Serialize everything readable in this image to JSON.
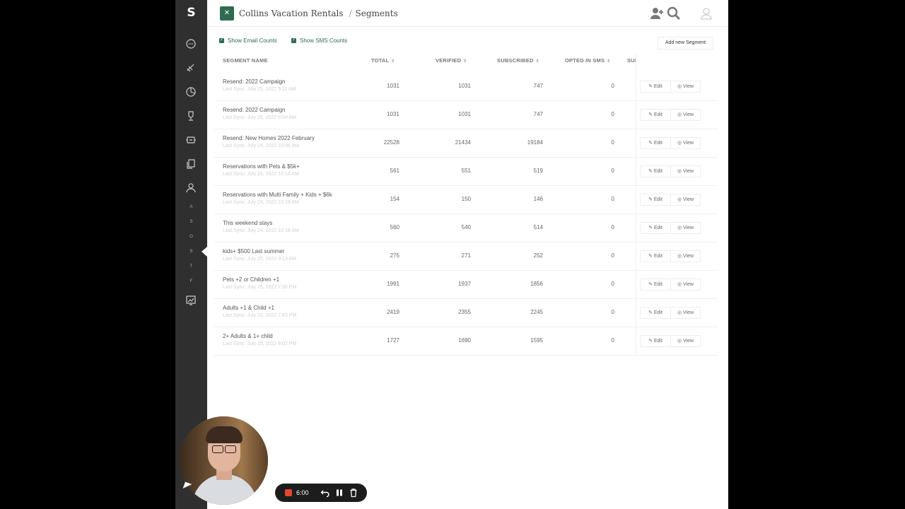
{
  "app": {
    "logo": "S",
    "account": "Collins Vacation Rentals",
    "section": "Segments"
  },
  "rail_letters": [
    "A",
    "S",
    "O",
    "S",
    "T",
    "F"
  ],
  "toggles": {
    "email": "Show Email Counts",
    "sms": "Show SMS Counts"
  },
  "add_button": "Add new Segment",
  "columns": {
    "name": "SEGMENT NAME",
    "total": "TOTAL",
    "verified": "VERIFIED",
    "subscribed": "SUBSCRIBED",
    "opted_sms": "OPTED IN SMS",
    "sub_cut": "SUI"
  },
  "rows": [
    {
      "name": "Resend: 2022 Campaign",
      "sync": "Last Sync: July 25, 2022 9:11 AM",
      "total": "1031",
      "verified": "1031",
      "subscribed": "747",
      "opted_sms": "0"
    },
    {
      "name": "Resend: 2022 Campaign",
      "sync": "Last Sync: July 25, 2022 8:08 AM",
      "total": "1031",
      "verified": "1031",
      "subscribed": "747",
      "opted_sms": "0"
    },
    {
      "name": "Resend: New Homes 2022 February",
      "sync": "Last Sync: July 24, 2022 10:06 AM",
      "total": "22528",
      "verified": "21434",
      "subscribed": "19184",
      "opted_sms": "0"
    },
    {
      "name": "Reservations with Pets & $5k+",
      "sync": "Last Sync: July 24, 2022 10:18 AM",
      "total": "561",
      "verified": "551",
      "subscribed": "519",
      "opted_sms": "0"
    },
    {
      "name": "Reservations with Multi Family + Kids + $6k",
      "sync": "Last Sync: July 24, 2022 10:18 AM",
      "total": "154",
      "verified": "150",
      "subscribed": "146",
      "opted_sms": "0"
    },
    {
      "name": "This weekend stays",
      "sync": "Last Sync: July 24, 2022 10:18 AM",
      "total": "560",
      "verified": "540",
      "subscribed": "514",
      "opted_sms": "0"
    },
    {
      "name": "kids+ $500 Last summer",
      "sync": "Last Sync: July 25, 2022 9:13 AM",
      "total": "275",
      "verified": "271",
      "subscribed": "252",
      "opted_sms": "0"
    },
    {
      "name": "Pets +2 or Children +1",
      "sync": "Last Sync: July 25, 2022 7:38 PM",
      "total": "1991",
      "verified": "1937",
      "subscribed": "1856",
      "opted_sms": "0"
    },
    {
      "name": "Adults +1 & Child +1",
      "sync": "Last Sync: July 25, 2022 7:43 PM",
      "total": "2419",
      "verified": "2355",
      "subscribed": "2245",
      "opted_sms": "0"
    },
    {
      "name": "2+ Adults & 1+ child",
      "sync": "Last Sync: July 25, 2022 8:02 PM",
      "total": "1727",
      "verified": "1690",
      "subscribed": "1595",
      "opted_sms": "0"
    }
  ],
  "actions": {
    "edit": "Edit",
    "view": "View"
  },
  "recorder": {
    "time": "6:00"
  },
  "colors": {
    "brand": "#2e6b4f",
    "rail": "#2f2f2f",
    "record": "#e2472f"
  }
}
